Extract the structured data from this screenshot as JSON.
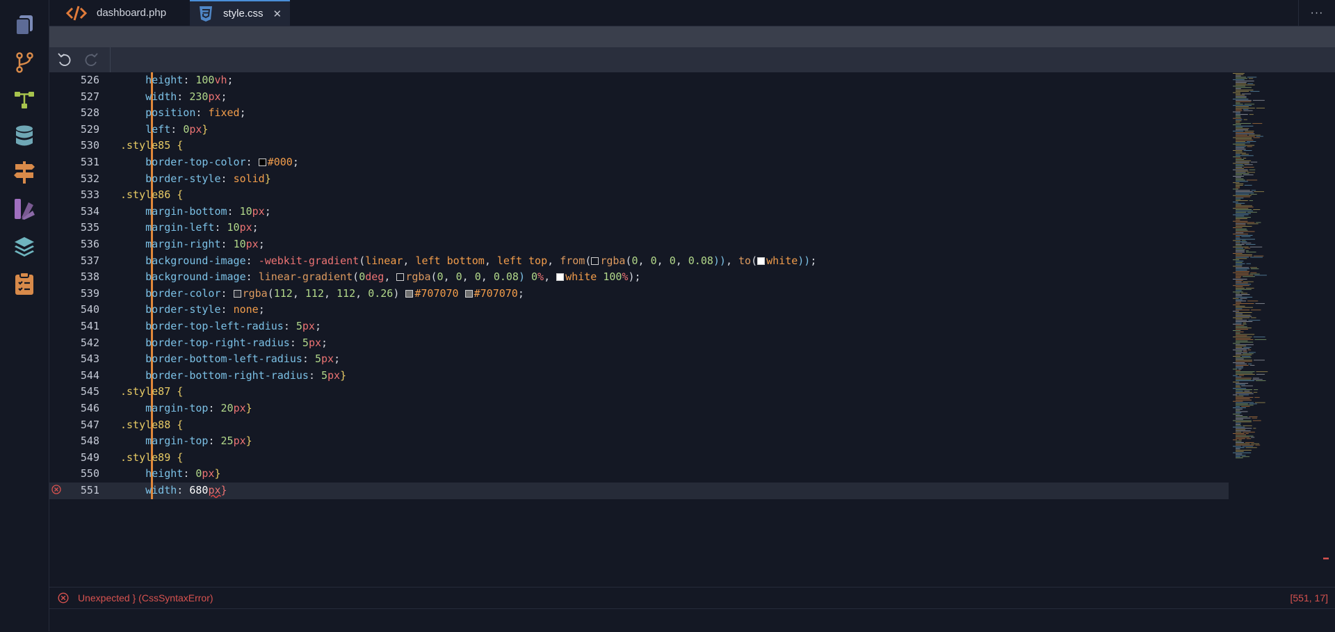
{
  "activity_bar": {
    "icons": [
      "files-icon",
      "git-branch-icon",
      "hierarchy-icon",
      "database-icon",
      "signpost-icon",
      "design-tools-icon",
      "layers-icon",
      "clipboard-icon"
    ]
  },
  "tabs": [
    {
      "label": "dashboard.php",
      "icon": "code-icon"
    },
    {
      "label": "style.css",
      "icon": "css-icon",
      "close": "✕"
    }
  ],
  "tab_more": "···",
  "status": {
    "message": "Unexpected } (CssSyntaxError)",
    "position": "[551, 17]"
  },
  "colors": {
    "accent": "#e0883a",
    "error": "#d8524f",
    "tab_indicator": "#4a8fd9"
  },
  "code_lines": [
    {
      "n": "526",
      "t": "    height: 100vh;"
    },
    {
      "n": "527",
      "t": "    width: 230px;"
    },
    {
      "n": "528",
      "t": "    position: fixed;"
    },
    {
      "n": "529",
      "t": "    left: 0px}"
    },
    {
      "n": "530",
      "t": ".style85 {"
    },
    {
      "n": "531",
      "t": "    border-top-color: #000;"
    },
    {
      "n": "532",
      "t": "    border-style: solid}"
    },
    {
      "n": "533",
      "t": ".style86 {"
    },
    {
      "n": "534",
      "t": "    margin-bottom: 10px;"
    },
    {
      "n": "535",
      "t": "    margin-left: 10px;"
    },
    {
      "n": "536",
      "t": "    margin-right: 10px;"
    },
    {
      "n": "537",
      "t": "    background-image: -webkit-gradient(linear, left bottom, left top, from(rgba(0, 0, 0, 0.08)), to(white));"
    },
    {
      "n": "538",
      "t": "    background-image: linear-gradient(0deg, rgba(0, 0, 0, 0.08) 0%, white 100%);"
    },
    {
      "n": "539",
      "t": "    border-color: rgba(112, 112, 112, 0.26) #707070 #707070;"
    },
    {
      "n": "540",
      "t": "    border-style: none;"
    },
    {
      "n": "541",
      "t": "    border-top-left-radius: 5px;"
    },
    {
      "n": "542",
      "t": "    border-top-right-radius: 5px;"
    },
    {
      "n": "543",
      "t": "    border-bottom-left-radius: 5px;"
    },
    {
      "n": "544",
      "t": "    border-bottom-right-radius: 5px}"
    },
    {
      "n": "545",
      "t": ".style87 {"
    },
    {
      "n": "546",
      "t": "    margin-top: 20px}"
    },
    {
      "n": "547",
      "t": ".style88 {"
    },
    {
      "n": "548",
      "t": "    margin-top: 25px}"
    },
    {
      "n": "549",
      "t": ".style89 {"
    },
    {
      "n": "550",
      "t": "    height: 0px}"
    },
    {
      "n": "551",
      "t": "    width: 680px}",
      "error": true
    }
  ]
}
